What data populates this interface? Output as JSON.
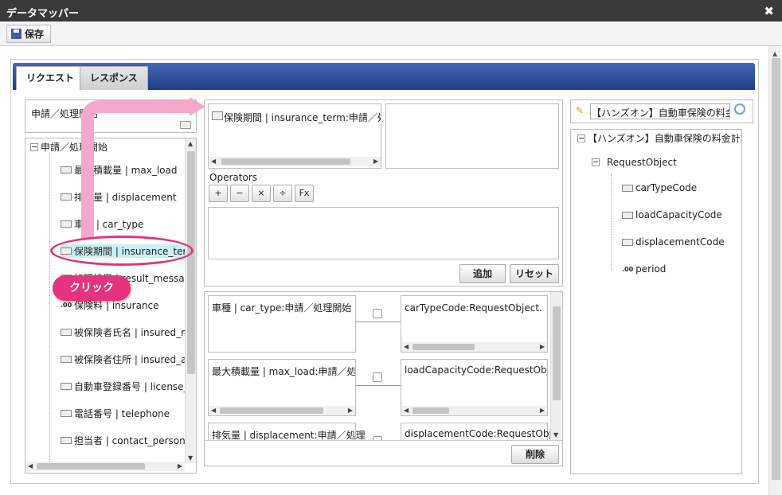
{
  "window": {
    "title": "データマッパー"
  },
  "toolbar": {
    "save_label": "保存"
  },
  "tabs": [
    {
      "label": "リクエスト"
    },
    {
      "label": "レスポンス"
    }
  ],
  "left": {
    "combo_value": "申請／処理開始",
    "root_label": "申請／処理開始",
    "items": [
      "最大積載量 | max_load",
      "排気量 | displacement",
      "車種 | car_type",
      "保険期間 | insurance_term",
      "処理結果 | result_message",
      "保険料 | insurance",
      "被保険者氏名 | insured_n",
      "被保険者住所 | insured_a",
      "自動車登録番号 | license_",
      "電話番号 | telephone",
      "担当者 | contact_personn"
    ]
  },
  "middle": {
    "expression_text": "保険期間 | insurance_term:申請／処理",
    "operators_label": "Operators",
    "operators": [
      "+",
      "−",
      "×",
      "÷",
      "Fx"
    ],
    "add_label": "追加",
    "reset_label": "リセット",
    "delete_label": "削除",
    "mappings": [
      {
        "source": "車種 | car_type:申請／処理開始",
        "target": "carTypeCode:RequestObject.【ハ"
      },
      {
        "source": "最大積載量 | max_load:申請／処理",
        "target": "loadCapacityCode:RequestObje"
      },
      {
        "source": "排気量 | displacement:申請／処理",
        "target": "displacementCode:RequestObje"
      }
    ]
  },
  "right": {
    "search_value": "【ハンズオン】自動車保険の料金計",
    "root_label": "【ハンズオン】自動車保険の料金計算",
    "object_label": "RequestObject",
    "fields": [
      "carTypeCode",
      "loadCapacityCode",
      "displacementCode",
      "period"
    ]
  },
  "callout": {
    "label": "クリック"
  },
  "colors": {
    "accent": "#e6337d",
    "tabbar": "#2c4a94"
  }
}
